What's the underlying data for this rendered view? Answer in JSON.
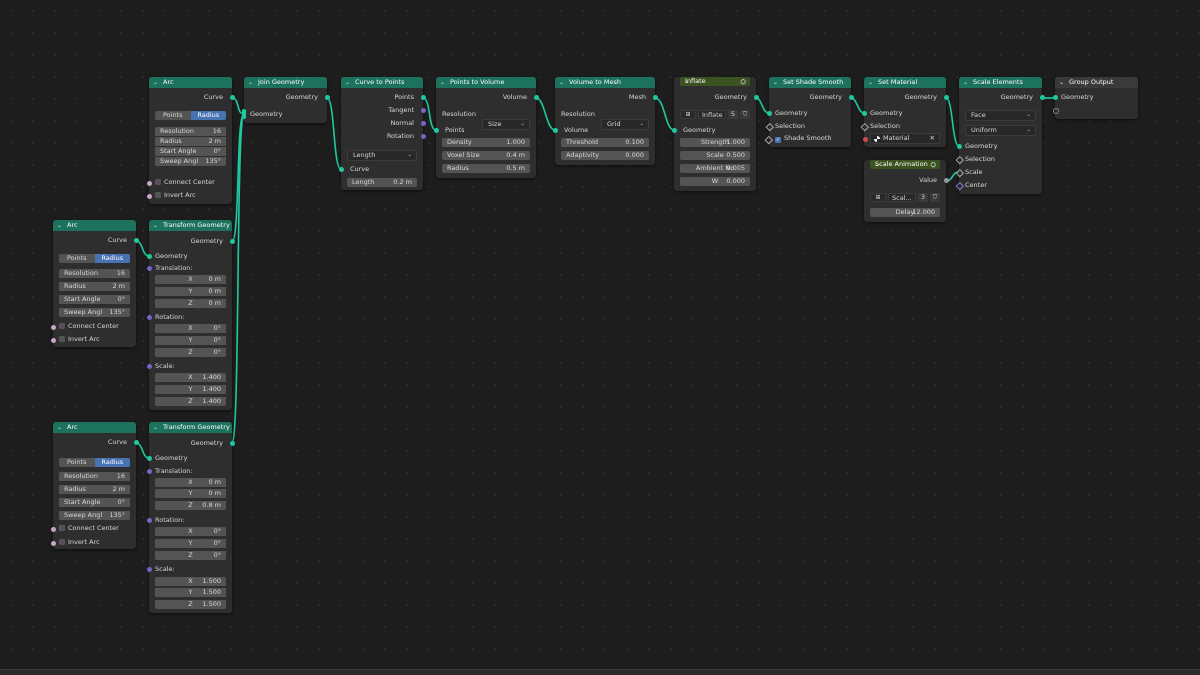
{
  "nodes": {
    "arc_a": {
      "title": "Arc",
      "out": "Curve",
      "mode_points": "Points",
      "mode_radius": "Radius",
      "rows": [
        {
          "label": "Resolution",
          "value": "16"
        },
        {
          "label": "Radius",
          "value": "2 m"
        },
        {
          "label": "Start Angle",
          "value": "0°"
        },
        {
          "label": "Sweep Angl",
          "value": "135°"
        }
      ],
      "connect_center": "Connect Center",
      "invert_arc": "Invert Arc"
    },
    "arc_b": {
      "title": "Arc",
      "out": "Curve",
      "mode_points": "Points",
      "mode_radius": "Radius",
      "rows": [
        {
          "label": "Resolution",
          "value": "16"
        },
        {
          "label": "Radius",
          "value": "2 m"
        },
        {
          "label": "Start Angle",
          "value": "0°"
        },
        {
          "label": "Sweep Angl",
          "value": "135°"
        }
      ],
      "connect_center": "Connect Center",
      "invert_arc": "Invert Arc"
    },
    "arc_c": {
      "title": "Arc",
      "out": "Curve",
      "mode_points": "Points",
      "mode_radius": "Radius",
      "rows": [
        {
          "label": "Resolution",
          "value": "16"
        },
        {
          "label": "Radius",
          "value": "2 m"
        },
        {
          "label": "Start Angle",
          "value": "0°"
        },
        {
          "label": "Sweep Angl",
          "value": "135°"
        }
      ],
      "connect_center": "Connect Center",
      "invert_arc": "Invert Arc"
    },
    "transform_1": {
      "title": "Transform Geometry",
      "out": "Geometry",
      "in": "Geometry",
      "translation": "Translation:",
      "rotation": "Rotation:",
      "scale": "Scale:",
      "t": [
        {
          "l": "X",
          "v": "0 m"
        },
        {
          "l": "Y",
          "v": "0 m"
        },
        {
          "l": "Z",
          "v": "0 m"
        }
      ],
      "r": [
        {
          "l": "X",
          "v": "0°"
        },
        {
          "l": "Y",
          "v": "0°"
        },
        {
          "l": "Z",
          "v": "0°"
        }
      ],
      "s": [
        {
          "l": "X",
          "v": "1.400"
        },
        {
          "l": "Y",
          "v": "1.400"
        },
        {
          "l": "Z",
          "v": "1.400"
        }
      ]
    },
    "transform_2": {
      "title": "Transform Geometry",
      "out": "Geometry",
      "in": "Geometry",
      "translation": "Translation:",
      "rotation": "Rotation:",
      "scale": "Scale:",
      "t": [
        {
          "l": "X",
          "v": "0 m"
        },
        {
          "l": "Y",
          "v": "0 m"
        },
        {
          "l": "Z",
          "v": "0.8 m"
        }
      ],
      "r": [
        {
          "l": "X",
          "v": "0°"
        },
        {
          "l": "Y",
          "v": "0°"
        },
        {
          "l": "Z",
          "v": "0°"
        }
      ],
      "s": [
        {
          "l": "X",
          "v": "1.500"
        },
        {
          "l": "Y",
          "v": "1.500"
        },
        {
          "l": "Z",
          "v": "1.500"
        }
      ]
    },
    "join": {
      "title": "Join Geometry",
      "out": "Geometry",
      "in": "Geometry"
    },
    "c2p": {
      "title": "Curve to Points",
      "outs": [
        "Points",
        "Tangent",
        "Normal",
        "Rotation"
      ],
      "mode": "Length",
      "in": "Curve",
      "length_label": "Length",
      "length_value": "0.2 m"
    },
    "p2v": {
      "title": "Points to Volume",
      "out": "Volume",
      "res_label": "Resolution",
      "res_value": "Size",
      "in": "Points",
      "rows": [
        {
          "label": "Density",
          "value": "1.000"
        },
        {
          "label": "Voxel Size",
          "value": "0.4 m"
        },
        {
          "label": "Radius",
          "value": "0.5 m"
        }
      ]
    },
    "v2m": {
      "title": "Volume to Mesh",
      "out": "Mesh",
      "res_label": "Resolution",
      "res_value": "Grid",
      "in": "Volume",
      "rows": [
        {
          "label": "Threshold",
          "value": "0.100"
        },
        {
          "label": "Adaptivity",
          "value": "0.000"
        }
      ]
    },
    "inflate": {
      "title": "Inflate",
      "out": "Geometry",
      "group_name": "Inflate",
      "users": "5",
      "in": "Geometry",
      "rows": [
        {
          "label": "Strength",
          "value": "1.000"
        },
        {
          "label": "Scale",
          "value": "0.500"
        },
        {
          "label": "Ambient No",
          "value": "0.005"
        },
        {
          "label": "W",
          "value": "0.000"
        }
      ]
    },
    "shade": {
      "title": "Set Shade Smooth",
      "out": "Geometry",
      "in": "Geometry",
      "selection": "Selection",
      "smooth": "Shade Smooth"
    },
    "material": {
      "title": "Set Material",
      "out": "Geometry",
      "in": "Geometry",
      "selection": "Selection",
      "mat": "Material",
      "close": "✕"
    },
    "scale_anim": {
      "title": "Scale Animation",
      "out": "Value",
      "group_name": "Scal...",
      "users": "3",
      "delay_label": "Delay",
      "delay_value": "12.000"
    },
    "scale_el": {
      "title": "Scale Elements",
      "out": "Geometry",
      "domain": "Face",
      "mode": "Uniform",
      "ins": [
        "Geometry",
        "Selection",
        "Scale",
        "Center"
      ]
    },
    "group_out": {
      "title": "Group Output",
      "in": "Geometry"
    }
  },
  "colors": {
    "geometry_link": "#1fc9a0",
    "geometry_header": "#1d725e",
    "field_header": "#3b5221",
    "selected": "#4772b3"
  }
}
